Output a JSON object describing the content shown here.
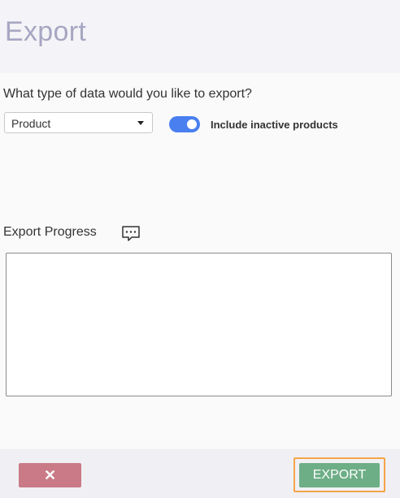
{
  "dialog": {
    "title": "Export"
  },
  "export_type": {
    "question": "What type of data would you like to export?",
    "selected": "Product",
    "icon": "chevron-down-icon"
  },
  "include_inactive": {
    "label": "Include inactive products",
    "enabled": true,
    "color": "#4a7ff0"
  },
  "progress": {
    "label": "Export Progress",
    "icon": "chat-bubble-icon",
    "log_text": ""
  },
  "footer": {
    "cancel_symbol": "✕",
    "export_label": "EXPORT",
    "cancel_color": "#c97a86",
    "export_color": "#6dae86",
    "focus_color": "#f5a447"
  }
}
